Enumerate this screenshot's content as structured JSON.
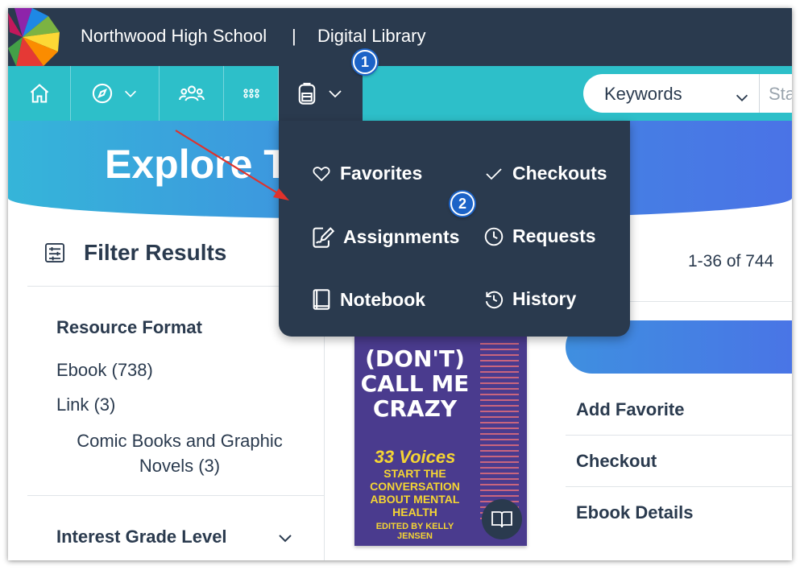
{
  "header": {
    "school": "Northwood High School",
    "separator": "|",
    "library": "Digital Library"
  },
  "navbar": {
    "search_type": "Keywords",
    "search_placeholder": "Sta"
  },
  "hero": {
    "title": "Explore T"
  },
  "menu": {
    "items": [
      {
        "label": "Favorites",
        "icon": "heart-icon"
      },
      {
        "label": "Checkouts",
        "icon": "check-icon"
      },
      {
        "label": "Assignments",
        "icon": "assignment-icon"
      },
      {
        "label": "Requests",
        "icon": "clock-icon"
      },
      {
        "label": "Notebook",
        "icon": "notebook-icon"
      },
      {
        "label": "History",
        "icon": "history-icon"
      }
    ]
  },
  "filters": {
    "title": "Filter Results",
    "sections": [
      {
        "title": "Resource Format",
        "options": [
          "Ebook (738)",
          "Link (3)",
          "Comic Books and Graphic Novels (3)"
        ]
      },
      {
        "title": "Interest Grade Level",
        "options": []
      }
    ]
  },
  "results": {
    "count": "1-36 of 744"
  },
  "book": {
    "title": "(DON'T) CALL ME CRAZY",
    "subtitle_big": "33 Voices",
    "subtitle": "START THE CONVERSATION ABOUT MENTAL HEALTH",
    "editor": "EDITED BY KELLY JENSEN"
  },
  "actions": [
    "Add Favorite",
    "Checkout",
    "Ebook Details"
  ],
  "annotations": {
    "badge1": "1",
    "badge2": "2"
  },
  "colors": {
    "header_bg": "#2a3a4e",
    "nav_bg": "#2dbfc9",
    "badge": "#1c63c7",
    "arrow": "#e0322b"
  }
}
